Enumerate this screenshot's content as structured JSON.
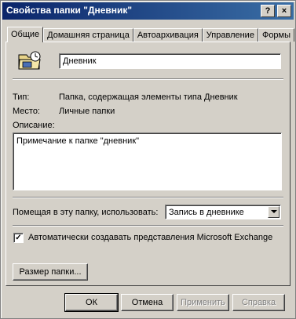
{
  "window": {
    "title": "Свойства папки \"Дневник\"",
    "help_label": "?",
    "close_label": "×"
  },
  "tabs": [
    {
      "label": "Общие",
      "active": true
    },
    {
      "label": "Домашняя страница",
      "active": false
    },
    {
      "label": "Автоархивация",
      "active": false
    },
    {
      "label": "Управление",
      "active": false
    },
    {
      "label": "Формы",
      "active": false
    }
  ],
  "general": {
    "folder_icon": "journal-folder-icon",
    "name_value": "Дневник",
    "type_label": "Тип:",
    "type_value": "Папка, содержащая элементы типа Дневник",
    "location_label": "Место:",
    "location_value": "Личные папки",
    "description_label": "Описание:",
    "description_value": "Примечание к папке \"дневник\"",
    "post_label": "Помещая в эту папку, использовать:",
    "post_value": "Запись в дневнике",
    "checkbox_checked": true,
    "checkbox_mark": "✓",
    "exchange_label": "Автоматически создавать представления Microsoft Exchange",
    "folder_size_button": "Размер папки..."
  },
  "buttons": {
    "ok": "ОК",
    "cancel": "Отмена",
    "apply": "Применить",
    "help": "Справка"
  },
  "colors": {
    "face": "#d4d0c8",
    "title_start": "#0a246a",
    "title_end": "#3a6ea5"
  }
}
